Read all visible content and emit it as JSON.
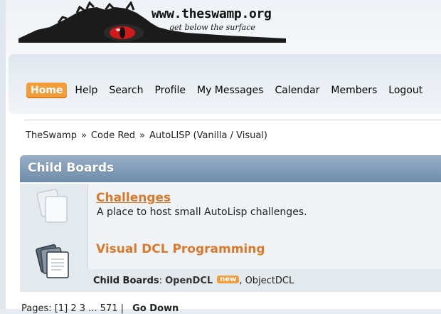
{
  "logo": {
    "url_text": "www.theswamp.org",
    "tagline": "get below the surface"
  },
  "menu": {
    "items": [
      {
        "label": "Home",
        "active": true
      },
      {
        "label": "Help"
      },
      {
        "label": "Search"
      },
      {
        "label": "Profile"
      },
      {
        "label": "My Messages"
      },
      {
        "label": "Calendar"
      },
      {
        "label": "Members"
      },
      {
        "label": "Logout"
      }
    ]
  },
  "breadcrumb": {
    "items": [
      "TheSwamp",
      "Code Red",
      "AutoLISP (Vanilla / Visual)"
    ],
    "separator": "»"
  },
  "child_boards": {
    "header": "Child Boards",
    "boards": [
      {
        "title": "Challenges",
        "description": "A place to host small AutoLisp challenges."
      },
      {
        "title": "Visual DCL Programming"
      }
    ],
    "sub_label": "Child Boards",
    "sub_items": [
      {
        "label": "OpenDCL",
        "badge": "new"
      },
      {
        "label": "ObjectDCL"
      }
    ]
  },
  "pagination": {
    "prefix": "Pages:",
    "current": "[1]",
    "rest": "2 3 ... 571",
    "divider": "|",
    "go_down": "Go Down"
  },
  "colors": {
    "accent": "#f39d3a",
    "board_link": "#d97a2b",
    "header_bar": "#7d98b4"
  }
}
